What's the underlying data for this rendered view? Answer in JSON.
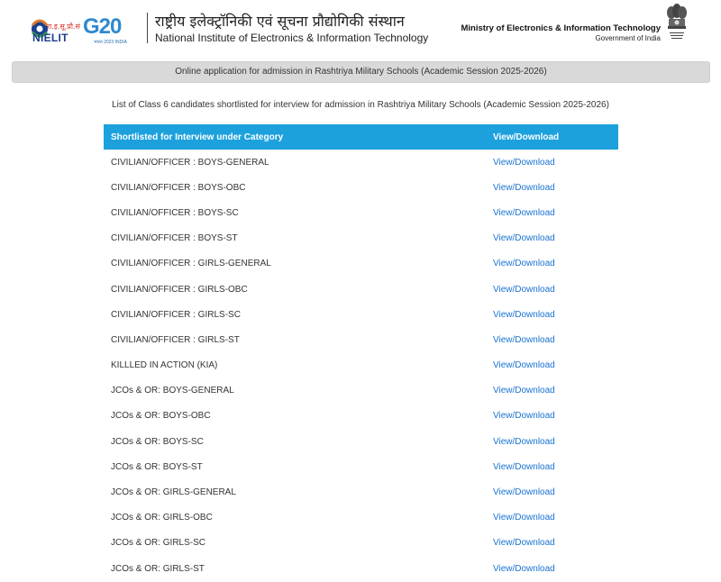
{
  "header": {
    "nielit_hindi": "रा.इ.सू.प्रौ.सं",
    "nielit_text": "NIELIT",
    "g20_text": "G20",
    "g20_tag": "भारत 2023 INDIA",
    "title_hindi": "राष्ट्रीय इलेक्ट्रॉनिकी एवं सूचना प्रौद्योगिकी संस्थान",
    "title_english": "National Institute of Electronics & Information Technology",
    "ministry": "Ministry of Electronics & Information Technology",
    "government": "Government of India"
  },
  "banner": "Online application for admission in Rashtriya Military Schools (Academic Session 2025-2026)",
  "subtitle": "List of Class 6 candidates shortlisted for interview for admission in Rashtriya Military Schools (Academic Session 2025-2026)",
  "table": {
    "headers": [
      "Shortlisted for Interview under Category",
      "View/Download"
    ],
    "rows": [
      {
        "category": "CIVILIAN/OFFICER : BOYS-GENERAL",
        "link": "View/Download"
      },
      {
        "category": "CIVILIAN/OFFICER : BOYS-OBC",
        "link": "View/Download"
      },
      {
        "category": "CIVILIAN/OFFICER : BOYS-SC",
        "link": "View/Download"
      },
      {
        "category": "CIVILIAN/OFFICER : BOYS-ST",
        "link": "View/Download"
      },
      {
        "category": "CIVILIAN/OFFICER : GIRLS-GENERAL",
        "link": "View/Download"
      },
      {
        "category": "CIVILIAN/OFFICER : GIRLS-OBC",
        "link": "View/Download"
      },
      {
        "category": "CIVILIAN/OFFICER : GIRLS-SC",
        "link": "View/Download"
      },
      {
        "category": "CIVILIAN/OFFICER : GIRLS-ST",
        "link": "View/Download"
      },
      {
        "category": "KILLLED IN ACTION (KIA)",
        "link": "View/Download"
      },
      {
        "category": "JCOs & OR: BOYS-GENERAL",
        "link": "View/Download"
      },
      {
        "category": "JCOs & OR: BOYS-OBC",
        "link": "View/Download"
      },
      {
        "category": "JCOs & OR: BOYS-SC",
        "link": "View/Download"
      },
      {
        "category": "JCOs & OR: BOYS-ST",
        "link": "View/Download"
      },
      {
        "category": "JCOs & OR: GIRLS-GENERAL",
        "link": "View/Download"
      },
      {
        "category": "JCOs & OR: GIRLS-OBC",
        "link": "View/Download"
      },
      {
        "category": "JCOs & OR: GIRLS-SC",
        "link": "View/Download"
      },
      {
        "category": "JCOs & OR: GIRLS-ST",
        "link": "View/Download"
      }
    ]
  },
  "colors": {
    "table_header": "#1ca1dc",
    "link": "#1a73d1",
    "banner_bg": "#d9d9d9"
  },
  "icons": [
    "nielit-logo-icon",
    "g20-logo-icon",
    "national-emblem-icon"
  ]
}
